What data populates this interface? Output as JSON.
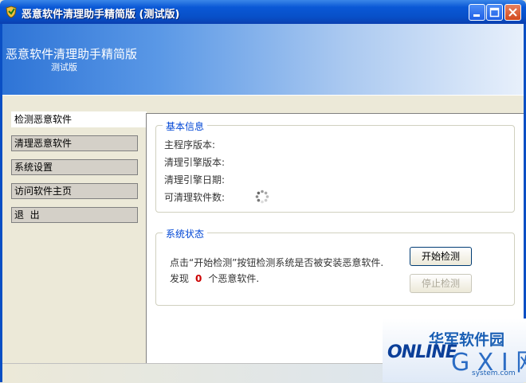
{
  "window": {
    "title": "恶意软件清理助手精简版 (测试版)"
  },
  "header": {
    "title": "恶意软件清理助手精简版",
    "subtitle": "测试版"
  },
  "sidebar": {
    "items": [
      {
        "label": "检测恶意软件",
        "active": true
      },
      {
        "label": "清理恶意软件",
        "active": false
      },
      {
        "label": "系统设置",
        "active": false
      },
      {
        "label": "访问软件主页",
        "active": false
      },
      {
        "label": "退  出",
        "active": false
      }
    ]
  },
  "basic_info": {
    "title": "基本信息",
    "main_version_label": "主程序版本:",
    "engine_version_label": "清理引擎版本:",
    "engine_date_label": "清理引擎日期:",
    "cleanable_count_label": "可清理软件数:"
  },
  "system_status": {
    "title": "系统状态",
    "instruction": "点击“开始检测”按钮检测系统是否被安装恶意软件.",
    "found_prefix": "发现",
    "found_count": "0",
    "found_suffix": "个恶意软件.",
    "start_button": "开始检测",
    "stop_button": "停止检测"
  },
  "watermark": {
    "cn": "华军软件园",
    "online": "ONLINE",
    "gxi": "G X I 网",
    "site": "system.com"
  }
}
